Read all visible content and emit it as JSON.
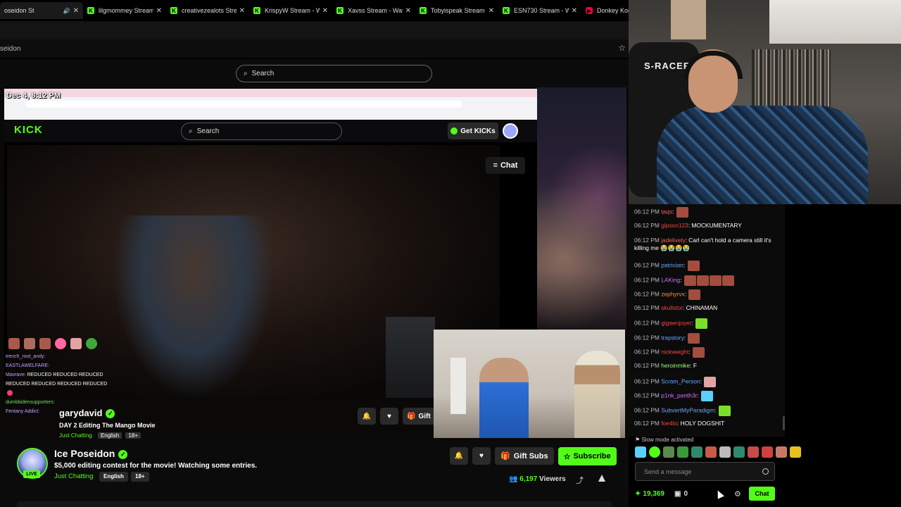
{
  "browser": {
    "tabs": [
      {
        "label": "oseidon St",
        "icon": "kick",
        "active": true
      },
      {
        "label": "lilgmommey Stream",
        "icon": "kick"
      },
      {
        "label": "creativezealots Stre",
        "icon": "kick"
      },
      {
        "label": "KrispyW Stream - W",
        "icon": "kick"
      },
      {
        "label": "Xavss Stream - Wat",
        "icon": "kick"
      },
      {
        "label": "Tobyispeak Stream",
        "icon": "kick"
      },
      {
        "label": "ESN730 Stream - W",
        "icon": "kick"
      },
      {
        "label": "Donkey Kong Coun",
        "icon": "youtube"
      }
    ],
    "address": "seidon"
  },
  "header": {
    "search_placeholder": "Search"
  },
  "screenshare": {
    "timestamp": "Dec 4, 8:12 PM",
    "logo": "KICK",
    "search_placeholder": "Search",
    "get_kicks": "Get KICKs",
    "chat_button": "Chat",
    "overlay_chat": [
      {
        "user": "trench_root_andy:",
        "text": ""
      },
      {
        "user": "EASTLAWELFARE:",
        "text": ""
      },
      {
        "user": "Mavrave:",
        "text": "REDUCED REDUCED REDUCED"
      },
      {
        "user": "",
        "text": "REDUCED REDUCED REDUCED REDUCED"
      },
      {
        "user": "dumbbidensupporters:",
        "text": ""
      },
      {
        "user": "Fentany Addict:",
        "text": ""
      }
    ],
    "channel_name": "garydavid",
    "stream_title": "DAY 2  Editing The Mango Movie",
    "category": "Just Chatting",
    "tags": [
      "English",
      "18+"
    ],
    "gift_label": "Gift"
  },
  "chat": {
    "messages": [
      {
        "time": "06:12 PM",
        "user": "taqs",
        "color": "#ff5a5a",
        "text": "",
        "emotes": 1
      },
      {
        "time": "06:12 PM",
        "user": "gipson123",
        "color": "#ff4040",
        "text": "MOCKUMENTARY",
        "emotes": 0
      },
      {
        "time": "06:12 PM",
        "user": "jadelively",
        "color": "#ff5a5a",
        "text": "Carl can't hold a camera still it's killing me 😭😭😭😭",
        "emotes": 0
      },
      {
        "time": "06:12 PM",
        "user": "patrician",
        "color": "#6aa8ff",
        "text": "",
        "emotes": 1
      },
      {
        "time": "06:12 PM",
        "user": "LAKing",
        "color": "#d66cff",
        "text": "",
        "emotes": 4
      },
      {
        "time": "06:12 PM",
        "user": "zephyrvx",
        "color": "#ff8a3a",
        "text": "",
        "emotes": 1
      },
      {
        "time": "06:12 PM",
        "user": "skullstor",
        "color": "#ff4040",
        "text": "CHINAMAN",
        "emotes": 0
      },
      {
        "time": "06:12 PM",
        "user": "gigaenjoyer",
        "color": "#ff4040",
        "text": "",
        "emotes": 1
      },
      {
        "time": "06:12 PM",
        "user": "trapstory",
        "color": "#6aa8ff",
        "text": "",
        "emotes": 1
      },
      {
        "time": "06:12 PM",
        "user": "nickweight",
        "color": "#ff4040",
        "text": "",
        "emotes": 1
      },
      {
        "time": "06:12 PM",
        "user": "heroinmike",
        "color": "#9dff7a",
        "text": "F",
        "emotes": 0
      },
      {
        "time": "06:12 PM",
        "user": "Scram_Person",
        "color": "#6aa8ff",
        "text": "",
        "emotes": 1
      },
      {
        "time": "06:12 PM",
        "user": "p1nk_panth3r",
        "color": "#d66cff",
        "text": "",
        "emotes": 1
      },
      {
        "time": "06:12 PM",
        "user": "SubvertMyParadigm",
        "color": "#6aa8ff",
        "text": "",
        "emotes": 1
      },
      {
        "time": "06:12 PM",
        "user": "foe4lo",
        "color": "#ff4040",
        "text": "HOLY DOGSHIT",
        "emotes": 0
      }
    ],
    "slow_mode": "Slow mode activated",
    "input_placeholder": "Send a message",
    "points": "19,369",
    "chest_count": "0",
    "send_label": "Chat"
  },
  "stream": {
    "channel_name": "Ice Poseidon",
    "live_badge": "LIVE",
    "title": "$5,000 editing contest for the movie! Watching some entries.",
    "category": "Just Chatting",
    "tags": [
      "English",
      "18+"
    ],
    "gift_subs": "Gift Subs",
    "subscribe": "Subscribe",
    "viewers_count": "6,197",
    "viewers_label": "Viewers"
  },
  "colors": {
    "accent": "#53fc18",
    "background": "#0b0b0b"
  }
}
